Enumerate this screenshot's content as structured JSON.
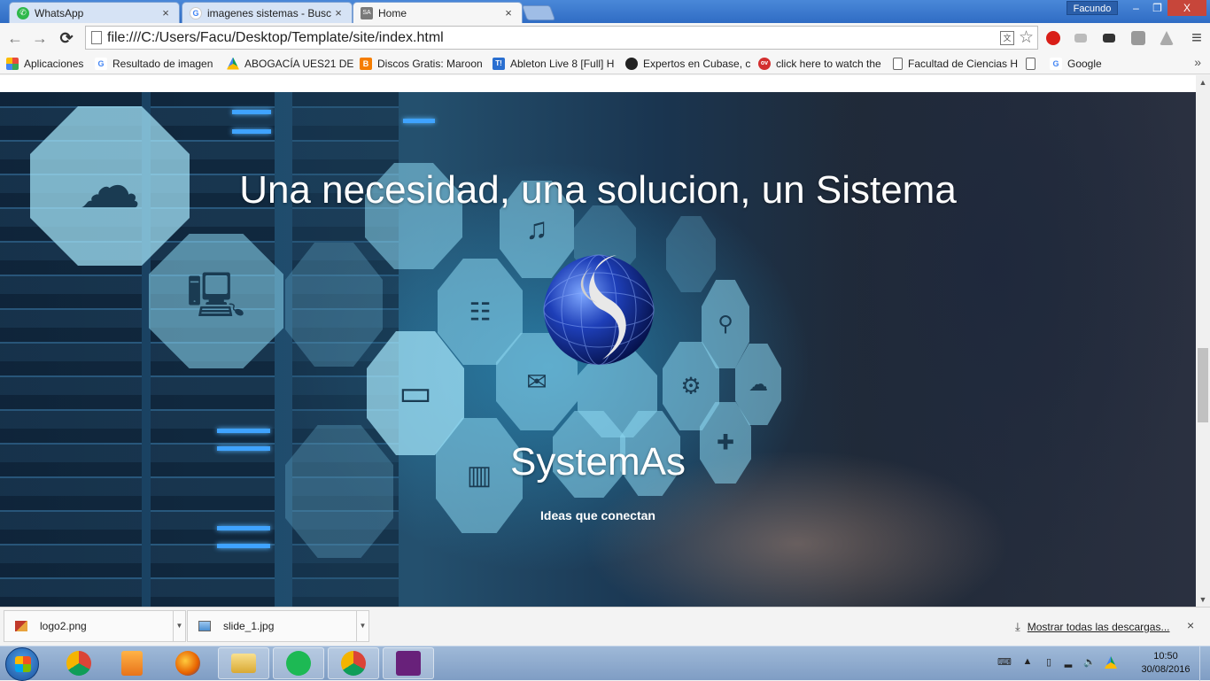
{
  "browser": {
    "tabs": [
      {
        "label": "WhatsApp",
        "icon": "whatsapp-icon",
        "active": false
      },
      {
        "label": "imagenes sistemas - Busc",
        "icon": "google-icon",
        "active": false
      },
      {
        "label": "Home",
        "icon": "sa-favicon",
        "favicon_text": "SA",
        "active": true
      }
    ],
    "close_glyph": "×",
    "user": "Facundo",
    "window_controls": {
      "minimize": "–",
      "restore": "❐",
      "close": "X"
    },
    "nav": {
      "back": "←",
      "forward": "→",
      "reload": "C"
    },
    "url": "file:///C:/Users/Facu/Desktop/Template/site/index.html",
    "star": "☆",
    "menu": "≡"
  },
  "bookmarks": [
    {
      "label": "Aplicaciones",
      "icon": "apps-grid-icon",
      "color": "#e84b3c"
    },
    {
      "label": "Resultado de imagen",
      "icon": "google-icon",
      "color": "#4285f4"
    },
    {
      "label": "ABOGACÍA UES21 DE",
      "icon": "google-drive-icon",
      "color": "#0f9d58"
    },
    {
      "label": "Discos Gratis: Maroon",
      "icon": "blogger-icon",
      "color": "#f57d00"
    },
    {
      "label": "Ableton Live 8 [Full] H",
      "icon": "taringa-icon",
      "color": "#2a6fd0",
      "glyph": "T!"
    },
    {
      "label": "Expertos en Cubase, c",
      "icon": "cubase-icon",
      "color": "#222222"
    },
    {
      "label": "click here to watch the",
      "icon": "ov-icon",
      "color": "#d32f2f",
      "glyph": "ov"
    },
    {
      "label": "Facultad de Ciencias H",
      "icon": "page-icon",
      "color": "#ffffff"
    },
    {
      "label": "",
      "icon": "page-icon",
      "color": "#ffffff"
    },
    {
      "label": "Google",
      "icon": "google-icon",
      "color": "#4285f4"
    }
  ],
  "bookmarks_more": "»",
  "page": {
    "hero_title": "Una necesidad, una solucion, un Sistema",
    "brand": "SystemAs",
    "tagline": "Ideas que conectan"
  },
  "downloads": {
    "items": [
      {
        "name": "logo2.png",
        "icon": "png-file-icon"
      },
      {
        "name": "slide_1.jpg",
        "icon": "jpg-file-icon"
      }
    ],
    "show_all": "Mostrar todas las descargas...",
    "close": "×"
  },
  "taskbar": {
    "apps": [
      {
        "name": "chrome",
        "icon": "chrome-icon",
        "open": false
      },
      {
        "name": "media-player",
        "icon": "media-player-icon",
        "open": false
      },
      {
        "name": "firefox",
        "icon": "firefox-icon",
        "open": false
      },
      {
        "name": "file-explorer",
        "icon": "folder-icon",
        "open": true
      },
      {
        "name": "spotify",
        "icon": "spotify-icon",
        "open": true
      },
      {
        "name": "chrome-window",
        "icon": "chrome-icon",
        "open": true
      },
      {
        "name": "visual-studio",
        "icon": "visual-studio-icon",
        "open": true
      }
    ],
    "time": "10:50",
    "date": "30/08/2016"
  },
  "colors": {
    "accent": "#2f6cc4",
    "led": "#3fa3ff"
  }
}
